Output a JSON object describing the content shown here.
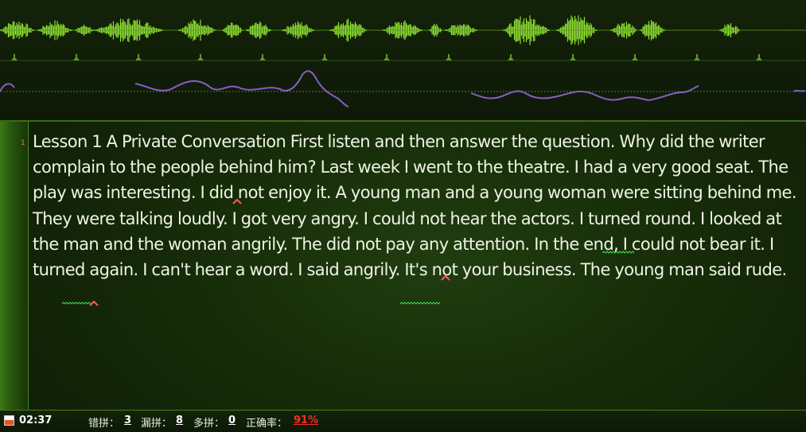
{
  "editor": {
    "line_number": "1",
    "transcript": "Lesson 1 A Private Conversation First listen and then answer the question. Why did the writer complain to the people behind him? Last week I went to the theatre. I had a very good seat. The play was interesting. I did not enjoy it. A young man and a young woman were sitting behind me. They were talking loudly. I got very angry. I could not hear the actors. I turned round. I looked at the man and the woman angrily. The did not pay any attention. In the end, I could not bear it. I turned again. I can't hear a word. I said angrily. It's not your business. The young man said rude."
  },
  "status": {
    "timer": "02:37",
    "wrong_label": "错拼：",
    "wrong_count": "3",
    "missing_label": "漏拼：",
    "missing_count": "8",
    "extra_label": "多拼：",
    "extra_count": "0",
    "accuracy_label": "正确率：",
    "accuracy_value": "91%"
  },
  "icons": {
    "record": "record-icon",
    "missing_word": "caret-icon",
    "wrong_word": "squiggle-underline"
  },
  "colors": {
    "waveform": "#7fd62a",
    "waveform_highlight": "#b8f56a",
    "pitch_curve": "#8a5cc8",
    "missing_marker": "#ff5a5a",
    "wrong_marker": "#3ee04a",
    "accuracy": "#ff2a2a"
  }
}
